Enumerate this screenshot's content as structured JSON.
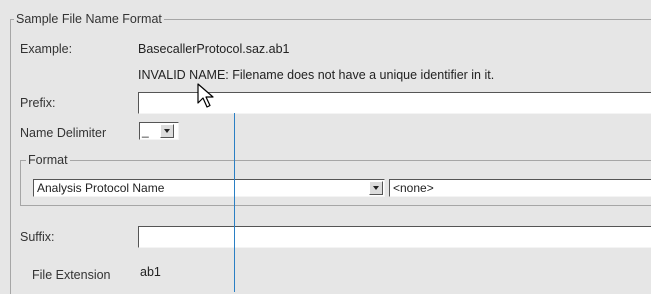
{
  "group": {
    "title": "Sample File Name Format",
    "example_label": "Example:",
    "example_value": "BasecallerProtocol.saz.ab1",
    "validation_message": "INVALID NAME:  Filename does not have a unique identifier in it.",
    "prefix_label": "Prefix:",
    "prefix_value": "",
    "delimiter_label": "Name Delimiter",
    "delimiter_value": "_",
    "format": {
      "title": "Format",
      "field1_value": "Analysis Protocol Name",
      "field2_value": "<none>"
    },
    "suffix_label": "Suffix:",
    "suffix_value": "",
    "extension_label": "File Extension",
    "extension_value": "ab1"
  },
  "colors": {
    "background": "#e6e6e6",
    "guide_line": "#2a7fc4"
  },
  "icons": {
    "cursor": "mouse-pointer-icon",
    "dropdown": "triangle-down-icon"
  }
}
